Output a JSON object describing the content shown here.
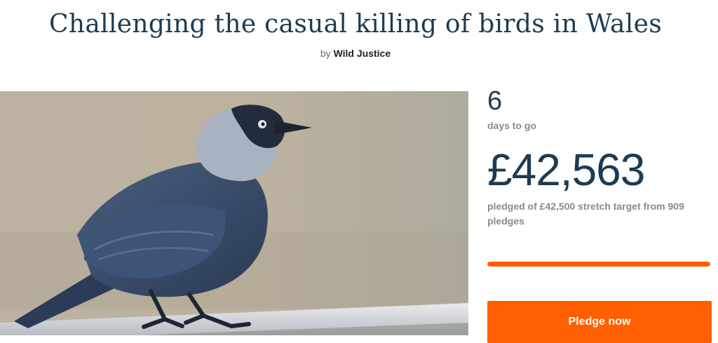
{
  "project": {
    "title": "Challenging the casual killing of birds in Wales",
    "by_prefix": "by",
    "author": "Wild Justice"
  },
  "hero_image": {
    "subject": "jackdaw-bird-photo"
  },
  "stats": {
    "days_number": "6",
    "days_label": "days to go",
    "amount": "£42,563",
    "pledged_text": "pledged of £42,500 stretch target from 909 pledges",
    "progress_percent": 100
  },
  "actions": {
    "pledge_label": "Pledge now"
  },
  "colors": {
    "accent": "#ff5f00",
    "heading": "#1d3b52",
    "muted": "#8a8a8a"
  }
}
